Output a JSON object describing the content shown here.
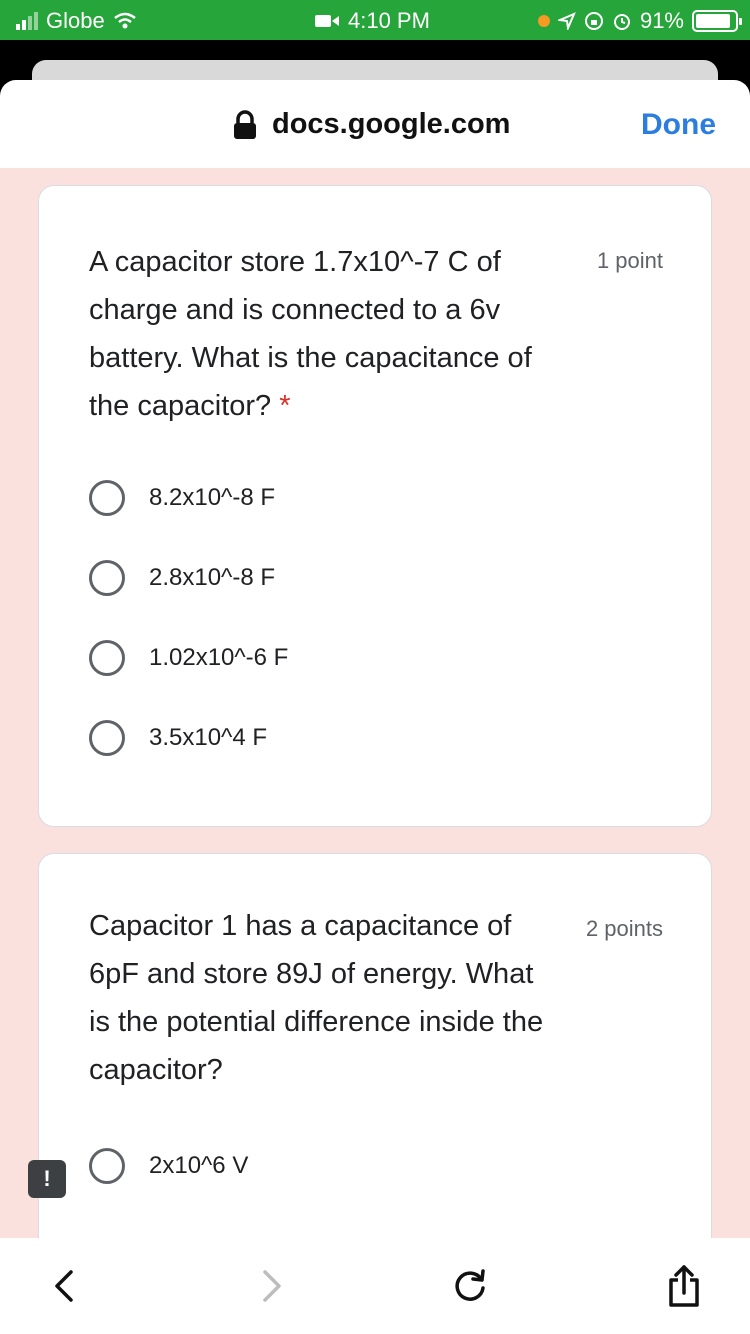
{
  "status_bar": {
    "carrier": "Globe",
    "time": "4:10 PM",
    "battery": "91%"
  },
  "browser": {
    "url": "docs.google.com",
    "done_label": "Done"
  },
  "questions": [
    {
      "text": "A capacitor store 1.7x10^-7 C of charge and is connected to a 6v battery. What is the capacitance of the capacitor?",
      "required_mark": "*",
      "points": "1 point",
      "options": [
        "8.2x10^-8 F",
        "2.8x10^-8 F",
        "1.02x10^-6 F",
        "3.5x10^4 F"
      ]
    },
    {
      "text": "Capacitor 1 has a capacitance of 6pF and store 89J of energy. What is the potential difference inside the capacitor?",
      "points": "2 points",
      "options": [
        "2x10^6 V"
      ]
    }
  ],
  "feedback_label": "!",
  "toolbar": {
    "icons": [
      "back-icon",
      "forward-icon",
      "refresh-icon",
      "share-icon"
    ]
  }
}
